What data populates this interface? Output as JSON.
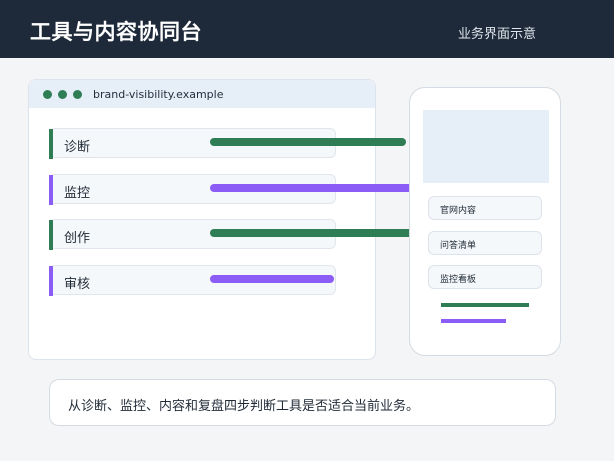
{
  "header": {
    "title": "工具与内容协同台",
    "subtitle": "业务界面示意"
  },
  "browser": {
    "url": "brand-visibility.example",
    "rows": [
      {
        "label": "诊断",
        "bar_fraction": 0.49,
        "color": "#2e7d55"
      },
      {
        "label": "监控",
        "bar_fraction": 0.57,
        "color": "#8b5cf6"
      },
      {
        "label": "创作",
        "bar_fraction": 0.66,
        "color": "#2e7d55"
      },
      {
        "label": "审核",
        "bar_fraction": 0.31,
        "color": "#8b5cf6"
      }
    ]
  },
  "phone": {
    "items": [
      {
        "label": "官网内容"
      },
      {
        "label": "问答清单"
      },
      {
        "label": "监控看板"
      }
    ],
    "bars": [
      {
        "color": "#2e7d55",
        "fraction": 1.0
      },
      {
        "color": "#8b5cf6",
        "fraction": 0.74
      }
    ]
  },
  "note": {
    "text": "从诊断、监控、内容和复盘四步判断工具是否适合当前业务。"
  },
  "colors": {
    "header_bg": "#1e2a3a",
    "green": "#2e7d55",
    "purple": "#8b5cf6"
  }
}
